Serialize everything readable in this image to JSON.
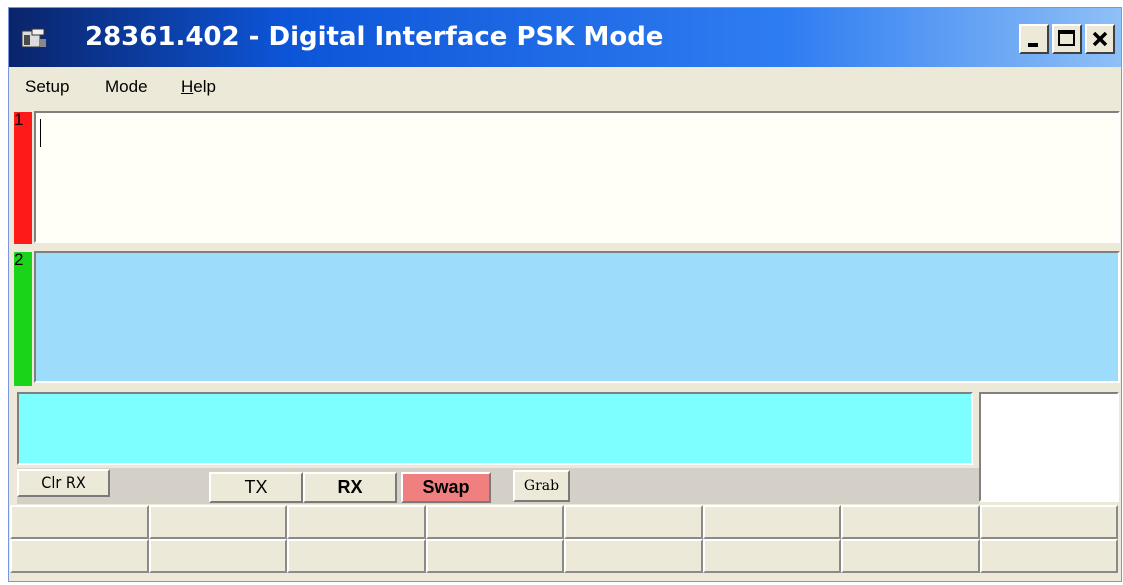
{
  "window": {
    "title": "28361.402 - Digital Interface PSK Mode",
    "icon": "app-window-icon",
    "controls": [
      "minimize-icon",
      "maximize-icon",
      "close-icon"
    ]
  },
  "menu": {
    "items": [
      {
        "label": "Setup"
      },
      {
        "label": "Mode"
      },
      {
        "label": "Help"
      }
    ]
  },
  "panes": {
    "pane1_number": "1",
    "pane2_number": "2",
    "pane1_color": "#fffff8",
    "pane2_color": "#9ddcfb",
    "pane3_color": "#7effff",
    "pane1_strip_color": "#ff1a1a",
    "pane2_strip_color": "#1ad41a"
  },
  "buttons": {
    "clr_rx": "Clr RX",
    "tx": "TX",
    "rx": "RX",
    "swap": "Swap",
    "grab": "Grab",
    "swap_color": "#f08080"
  },
  "macro_buttons": {
    "rows": 2,
    "columns": 8,
    "labels": [
      "",
      "",
      "",
      "",
      "",
      "",
      "",
      "",
      "",
      "",
      "",
      "",
      "",
      "",
      "",
      ""
    ]
  }
}
